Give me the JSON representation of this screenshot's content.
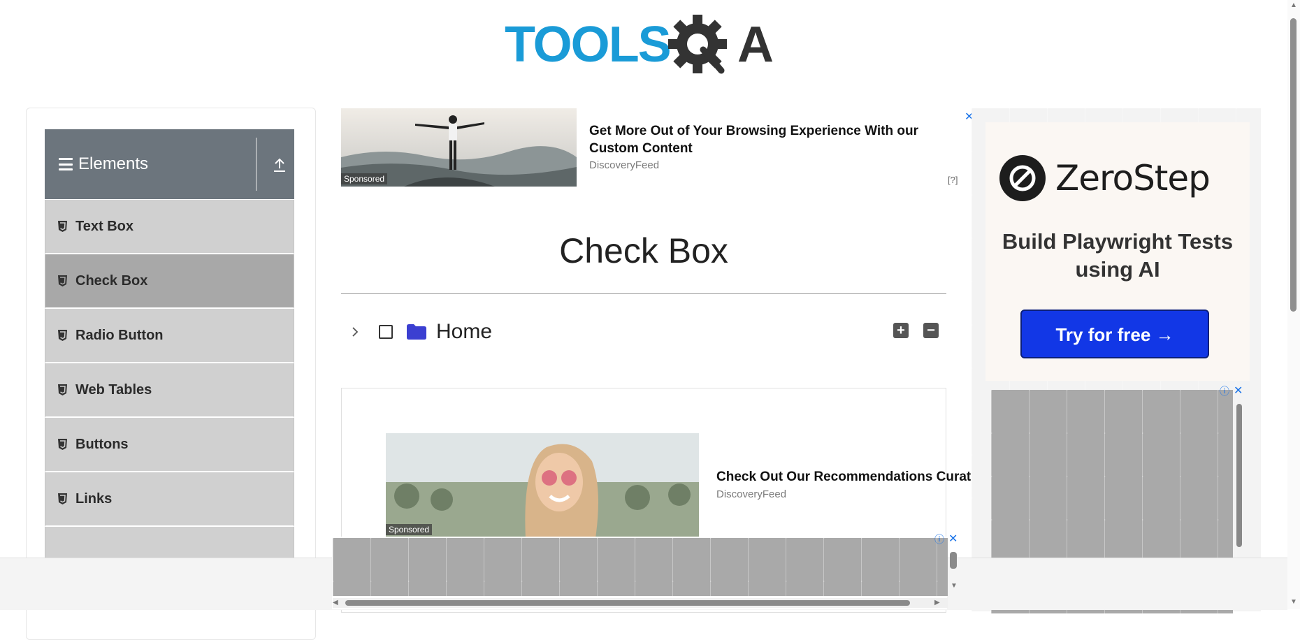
{
  "logo": {
    "text_left": "TOOLS",
    "text_right": "A"
  },
  "sidebar": {
    "group_title": "Elements",
    "items": [
      {
        "label": "Text Box",
        "active": false
      },
      {
        "label": "Check Box",
        "active": true
      },
      {
        "label": "Radio Button",
        "active": false
      },
      {
        "label": "Web Tables",
        "active": false
      },
      {
        "label": "Buttons",
        "active": false
      },
      {
        "label": "Links",
        "active": false
      },
      {
        "label": "",
        "active": false
      }
    ]
  },
  "ad_top": {
    "title": "Get More Out of Your Browsing Experience With our Custom Content",
    "source": "DiscoveryFeed",
    "sponsored": "Sponsored",
    "close": "✕",
    "info": "[?]"
  },
  "main": {
    "title": "Check Box",
    "tree": {
      "label": "Home",
      "expand_all": "+",
      "collapse_all": "−"
    }
  },
  "ad_bottom": {
    "title": "Check Out Our Recommendations Curated for You",
    "source": "DiscoveryFeed",
    "sponsored": "Sponsored"
  },
  "right_ad": {
    "brand": "ZeroStep",
    "tagline": "Build Playwright Tests using AI",
    "cta": "Try for free →",
    "close": "✕",
    "info": "ⓘ"
  },
  "bottom_banner": {
    "close": "✕",
    "info": "ⓘ"
  },
  "colors": {
    "logo_blue": "#1a9bd7",
    "logo_dark": "#333333",
    "sidebar_header": "#6c757d",
    "menu_item": "#d0d0d0",
    "menu_active": "#a8a8a8",
    "folder": "#3b3fd1",
    "cta_blue": "#1237e6"
  }
}
